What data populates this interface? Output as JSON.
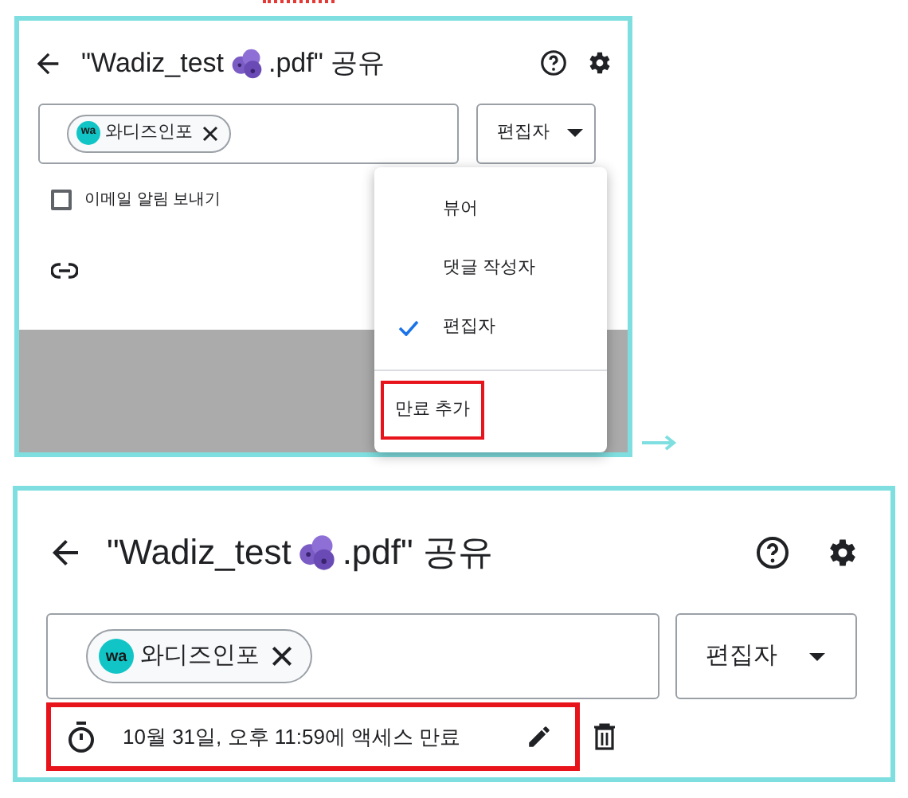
{
  "step1": {
    "title_start": "\"Wadiz_test",
    "title_end": ".pdf\" 공유",
    "chip": {
      "initials": "wa",
      "name": "와디즈인포"
    },
    "role": "편집자",
    "notify": {
      "label": "이메일 알림 보내기",
      "checked": false
    },
    "menu": {
      "items": [
        {
          "label": "뷰어",
          "selected": false
        },
        {
          "label": "댓글 작성자",
          "selected": false
        },
        {
          "label": "편집자",
          "selected": true
        }
      ],
      "footer": {
        "label": "만료 추가",
        "highlighted": true
      }
    }
  },
  "step2": {
    "title_start": "\"Wadiz_test",
    "title_end": ".pdf\" 공유",
    "chip": {
      "initials": "wa",
      "name": "와디즈인포"
    },
    "role": "편집자",
    "expiry": {
      "text": "10월 31일, 오후 11:59에 액세스 만료",
      "highlighted": true
    }
  }
}
